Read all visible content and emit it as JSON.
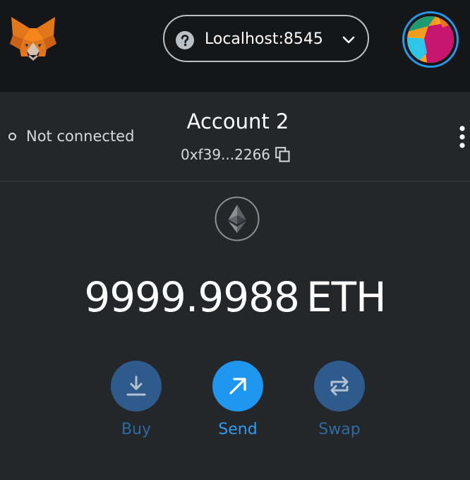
{
  "app": {
    "name": "MetaMask",
    "accent_color": "#1f96ef"
  },
  "header": {
    "logo_icon": "metamask-fox-icon",
    "network": {
      "label": "Localhost:8545",
      "status_icon": "question-mark-icon",
      "dropdown_icon": "chevron-down-icon"
    },
    "account_avatar_icon": "jazzicon-avatar-icon"
  },
  "account": {
    "connection_status": "Not connected",
    "name": "Account 2",
    "address": "0xf39...2266",
    "copy_icon": "copy-icon",
    "menu_icon": "kebab-menu-icon"
  },
  "balance": {
    "asset_icon": "ethereum-icon",
    "amount": "9999.9988",
    "unit": "ETH"
  },
  "actions": [
    {
      "label": "Buy",
      "icon": "download-icon",
      "state": "disabled"
    },
    {
      "label": "Send",
      "icon": "arrow-up-right-icon",
      "state": "enabled"
    },
    {
      "label": "Swap",
      "icon": "swap-arrows-icon",
      "state": "disabled"
    }
  ]
}
